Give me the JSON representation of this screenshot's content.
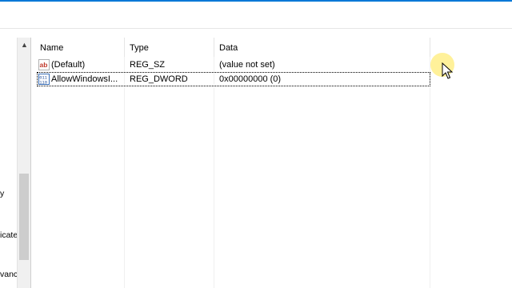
{
  "tree": {
    "items": [
      {
        "label": "y"
      },
      {
        "label": "icate"
      },
      {
        "label": "vanc"
      }
    ]
  },
  "list": {
    "columns": {
      "name": "Name",
      "type": "Type",
      "data": "Data"
    },
    "rows": [
      {
        "icon": "string-value-icon",
        "name": "(Default)",
        "type": "REG_SZ",
        "data": "(value not set)"
      },
      {
        "icon": "dword-value-icon",
        "name": "AllowWindowsI...",
        "type": "REG_DWORD",
        "data": "0x00000000 (0)"
      }
    ]
  },
  "colors": {
    "accent": "#0078d7",
    "cursor_highlight": "#ffe878"
  }
}
